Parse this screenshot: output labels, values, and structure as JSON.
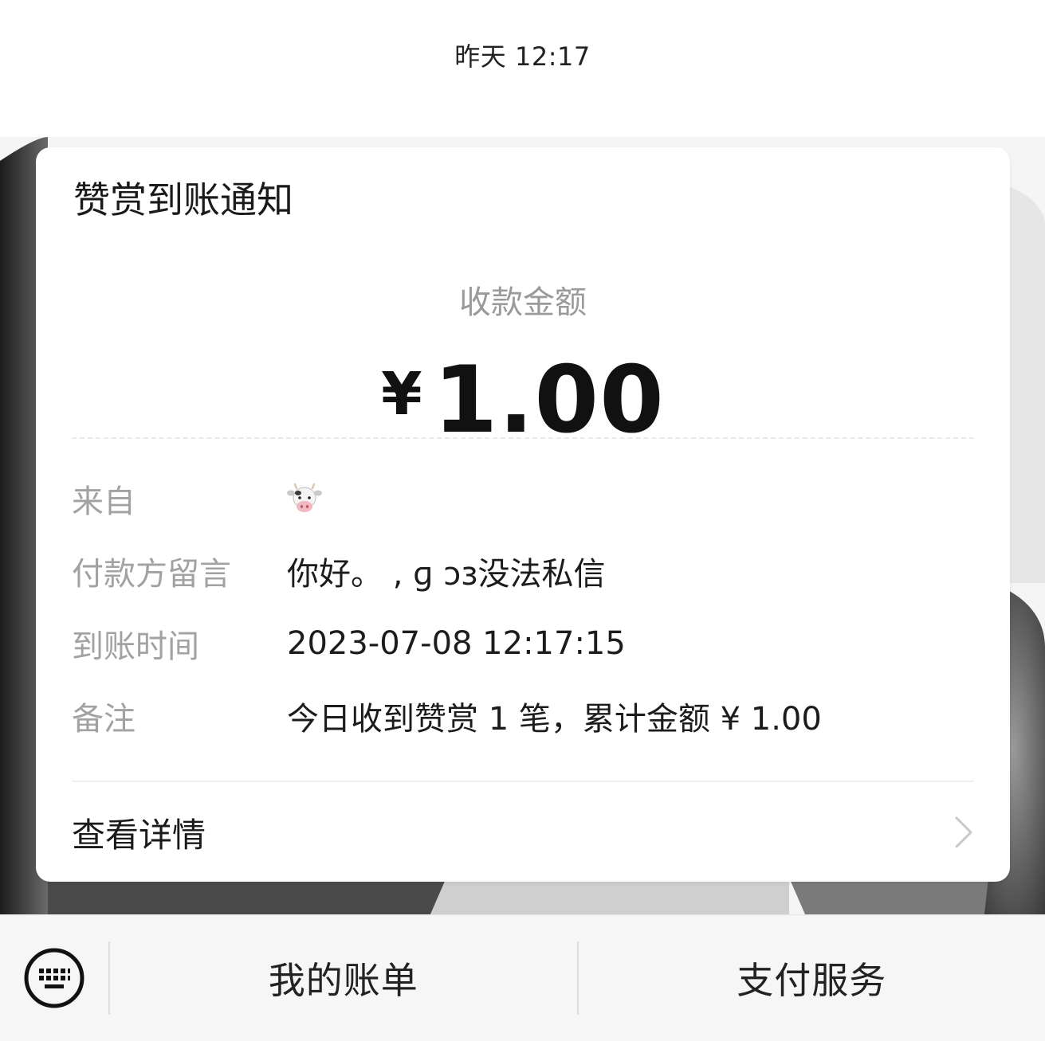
{
  "header": {
    "timestamp": "昨天 12:17"
  },
  "card": {
    "title": "赞赏到账通知",
    "amount_label": "收款金额",
    "currency_symbol": "¥",
    "amount": "1.00",
    "rows": [
      {
        "label": "来自",
        "value": "",
        "icon": "cow-face-icon"
      },
      {
        "label": "付款方留言",
        "value": "你好。 ,  ɡ  ɔɜ没法私信"
      },
      {
        "label": "到账时间",
        "value": "2023-07-08 12:17:15"
      },
      {
        "label": "备注",
        "value": "今日收到赞赏 1 笔，累计金额 ¥ 1.00"
      }
    ],
    "details_label": "查看详情"
  },
  "bottom_bar": {
    "keyboard_icon": "keyboard-icon",
    "menu_items": [
      "我的账单",
      "支付服务"
    ]
  },
  "colors": {
    "card_bg": "#ffffff",
    "label_gray": "#a2a2a2",
    "bar_bg": "#f6f6f6"
  }
}
